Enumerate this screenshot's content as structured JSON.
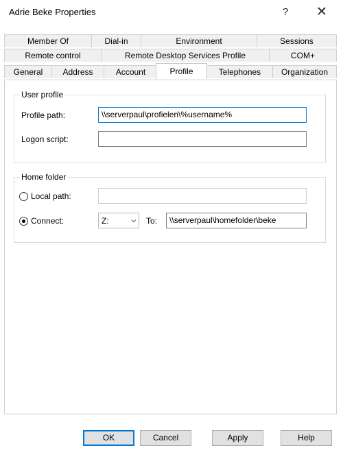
{
  "window": {
    "title": "Adrie Beke Properties",
    "help_glyph": "?",
    "close_glyph": "✕"
  },
  "tabs": {
    "row1": [
      "Member Of",
      "Dial-in",
      "Environment",
      "Sessions"
    ],
    "row2": [
      "Remote control",
      "Remote Desktop Services Profile",
      "COM+"
    ],
    "row3": [
      "General",
      "Address",
      "Account",
      "Profile",
      "Telephones",
      "Organization"
    ],
    "active": "Profile"
  },
  "user_profile": {
    "group_label": "User profile",
    "profile_path_label": "Profile path:",
    "profile_path_value": "\\\\serverpaul\\profielen\\%username%",
    "logon_script_label": "Logon script:",
    "logon_script_value": ""
  },
  "home_folder": {
    "group_label": "Home folder",
    "local_path_label": "Local path:",
    "local_path_value": "",
    "connect_label": "Connect:",
    "drive_value": "Z:",
    "to_label": "To:",
    "to_value": "\\\\serverpaul\\homefolder\\beke",
    "selected_option": "connect"
  },
  "buttons": {
    "ok": "OK",
    "cancel": "Cancel",
    "apply": "Apply",
    "help": "Help"
  }
}
